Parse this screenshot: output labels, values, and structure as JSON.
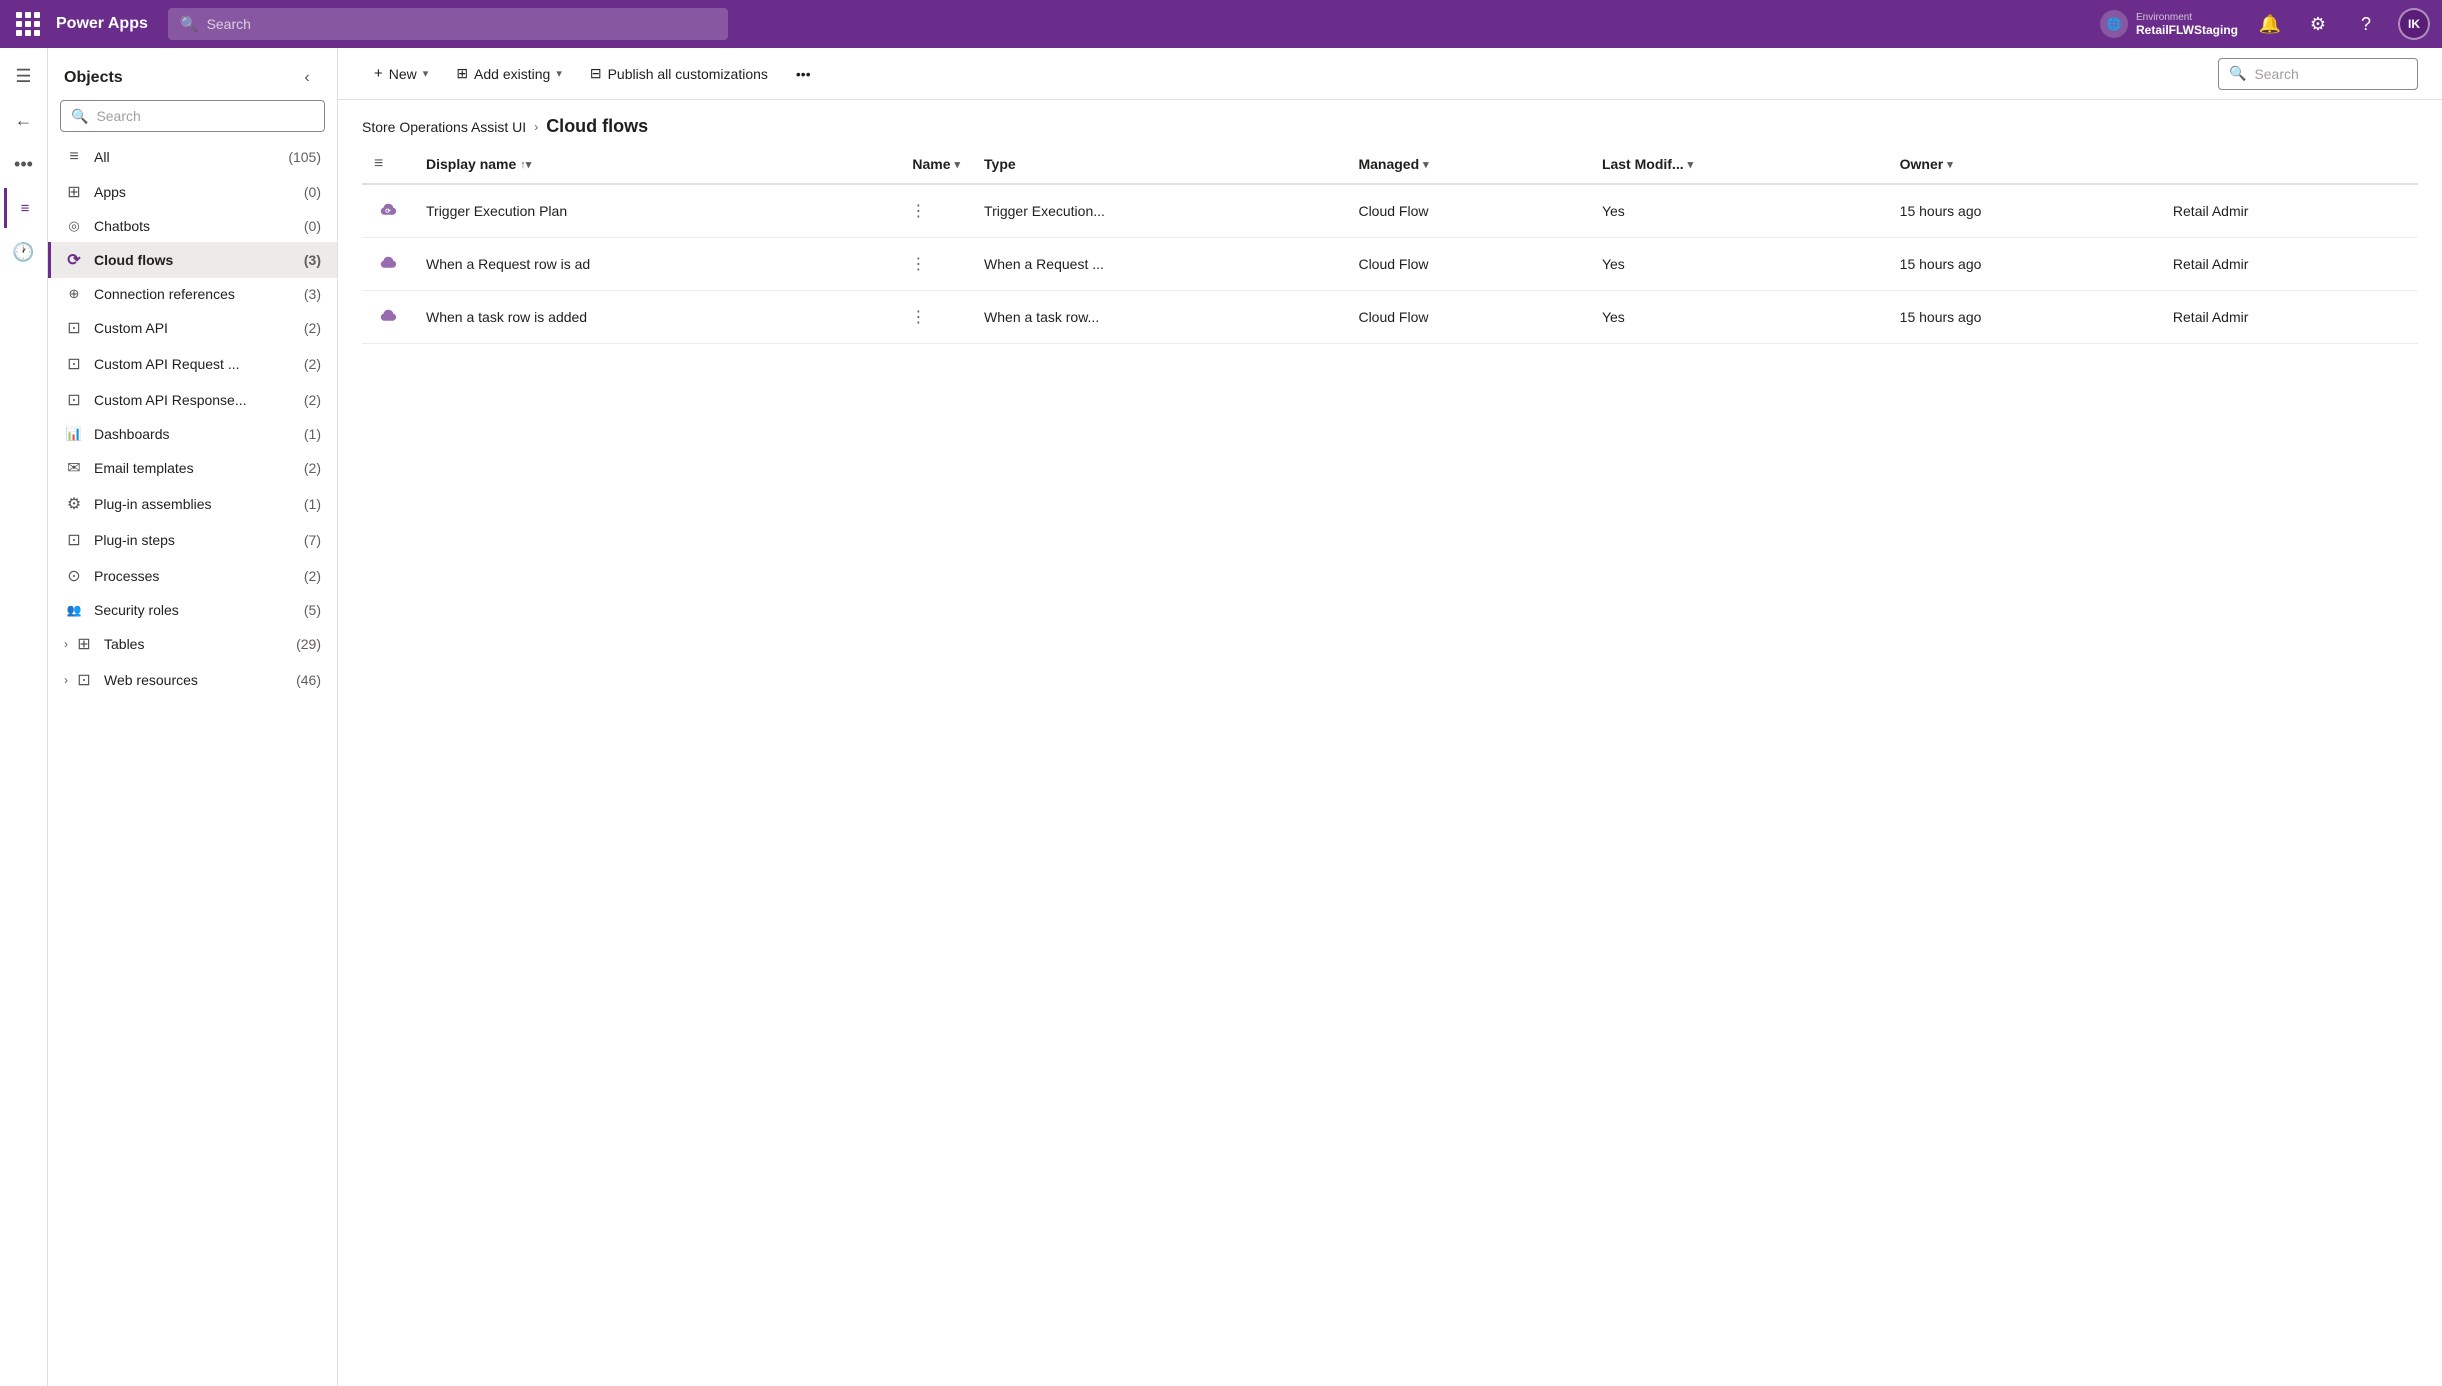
{
  "app": {
    "title": "Power Apps",
    "search_placeholder": "Search"
  },
  "environment": {
    "label": "Environment",
    "name": "RetailFLWStaging"
  },
  "user_initials": "IK",
  "top_search_placeholder": "Search",
  "sidebar": {
    "title": "Objects",
    "search_placeholder": "Search",
    "items": [
      {
        "id": "all",
        "label": "All",
        "count": "(105)",
        "icon": "≡"
      },
      {
        "id": "apps",
        "label": "Apps",
        "count": "(0)",
        "icon": "⊞"
      },
      {
        "id": "chatbots",
        "label": "Chatbots",
        "count": "(0)",
        "icon": "☊"
      },
      {
        "id": "cloud-flows",
        "label": "Cloud flows",
        "count": "(3)",
        "icon": "⟳",
        "active": true
      },
      {
        "id": "connection-refs",
        "label": "Connection references",
        "count": "(3)",
        "icon": "⊕"
      },
      {
        "id": "custom-api",
        "label": "Custom API",
        "count": "(2)",
        "icon": "⊡"
      },
      {
        "id": "custom-api-request",
        "label": "Custom API Request ...",
        "count": "(2)",
        "icon": "⊡"
      },
      {
        "id": "custom-api-response",
        "label": "Custom API Response...",
        "count": "(2)",
        "icon": "⊡"
      },
      {
        "id": "dashboards",
        "label": "Dashboards",
        "count": "(1)",
        "icon": "📊"
      },
      {
        "id": "email-templates",
        "label": "Email templates",
        "count": "(2)",
        "icon": "✉"
      },
      {
        "id": "plugin-assemblies",
        "label": "Plug-in assemblies",
        "count": "(1)",
        "icon": "⚙"
      },
      {
        "id": "plugin-steps",
        "label": "Plug-in steps",
        "count": "(7)",
        "icon": "⊡"
      },
      {
        "id": "processes",
        "label": "Processes",
        "count": "(2)",
        "icon": "⊙"
      },
      {
        "id": "security-roles",
        "label": "Security roles",
        "count": "(5)",
        "icon": "👥"
      },
      {
        "id": "tables",
        "label": "Tables",
        "count": "(29)",
        "icon": "⊞",
        "expandable": true
      },
      {
        "id": "web-resources",
        "label": "Web resources",
        "count": "(46)",
        "icon": "⊡",
        "expandable": true
      }
    ]
  },
  "toolbar": {
    "new_label": "New",
    "add_existing_label": "Add existing",
    "publish_label": "Publish all customizations",
    "search_placeholder": "Search"
  },
  "breadcrumb": {
    "parent_label": "Store Operations Assist UI",
    "separator": "›",
    "current_label": "Cloud flows"
  },
  "table": {
    "columns": [
      {
        "id": "display-name",
        "label": "Display name",
        "sortable": true,
        "sort_active": true,
        "sort_dir": "asc"
      },
      {
        "id": "name",
        "label": "Name",
        "sortable": true
      },
      {
        "id": "type",
        "label": "Type",
        "sortable": false
      },
      {
        "id": "managed",
        "label": "Managed",
        "sortable": true
      },
      {
        "id": "last-modified",
        "label": "Last Modif...",
        "sortable": true
      },
      {
        "id": "owner",
        "label": "Owner",
        "sortable": true
      }
    ],
    "rows": [
      {
        "id": 1,
        "display_name": "Trigger Execution Plan",
        "name": "Trigger Execution...",
        "type": "Cloud Flow",
        "managed": "Yes",
        "last_modified": "15 hours ago",
        "owner": "Retail Admir"
      },
      {
        "id": 2,
        "display_name": "When a Request row is ad",
        "name": "When a Request ...",
        "type": "Cloud Flow",
        "managed": "Yes",
        "last_modified": "15 hours ago",
        "owner": "Retail Admir"
      },
      {
        "id": 3,
        "display_name": "When a task row is added",
        "name": "When a task row...",
        "type": "Cloud Flow",
        "managed": "Yes",
        "last_modified": "15 hours ago",
        "owner": "Retail Admir"
      }
    ]
  }
}
